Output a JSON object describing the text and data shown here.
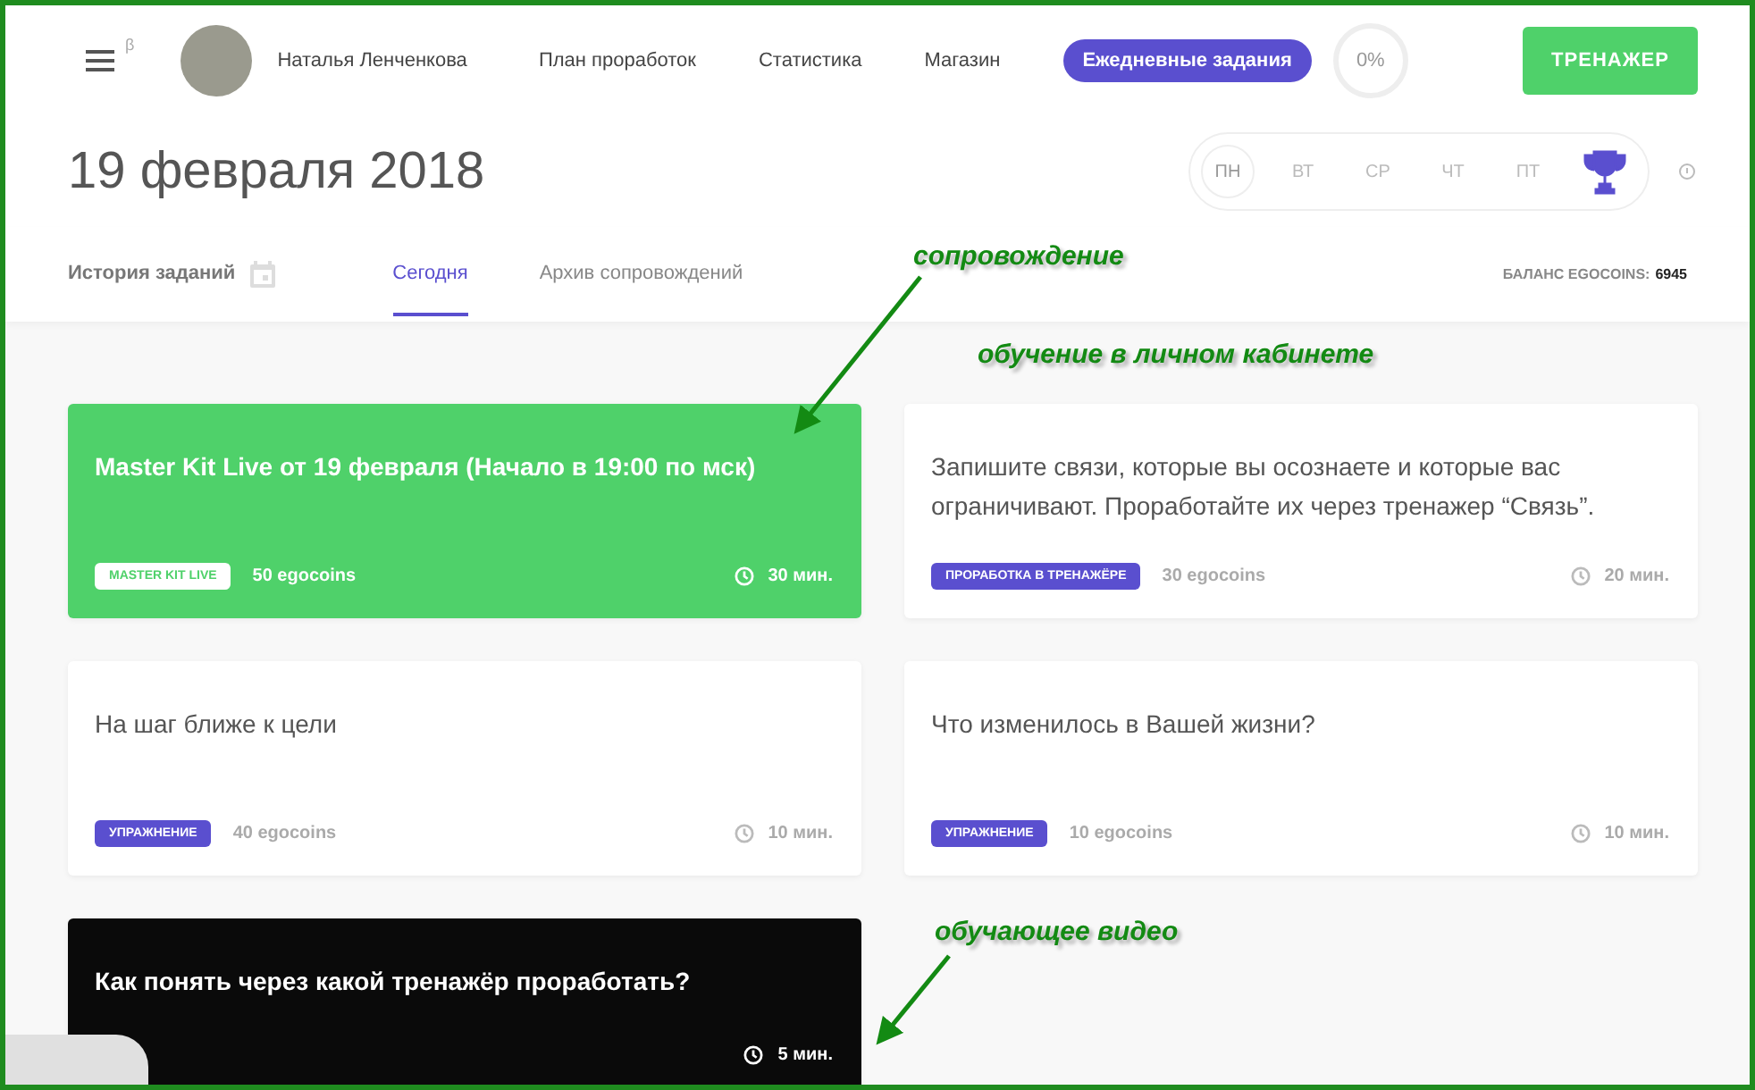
{
  "header": {
    "beta_mark": "β",
    "user_name": "Наталья Ленченкова",
    "nav": [
      {
        "label": "План проработок",
        "selected": false
      },
      {
        "label": "Статистика",
        "selected": false
      },
      {
        "label": "Магазин",
        "selected": false
      },
      {
        "label": "Ежедневные задания",
        "selected": true
      }
    ],
    "progress": "0%",
    "trainer_button": "ТРЕНАЖЕР"
  },
  "date_title": "19 февраля 2018",
  "week_days": [
    {
      "label": "ПН",
      "selected": true
    },
    {
      "label": "ВТ",
      "selected": false
    },
    {
      "label": "СР",
      "selected": false
    },
    {
      "label": "ЧТ",
      "selected": false
    },
    {
      "label": "ПТ",
      "selected": false
    }
  ],
  "tabs": [
    {
      "label": "История заданий",
      "kind": "history",
      "selected": false
    },
    {
      "label": "Сегодня",
      "kind": "tab",
      "selected": true
    },
    {
      "label": "Архив сопровождений",
      "kind": "tab",
      "selected": false
    }
  ],
  "balance": {
    "label": "БАЛАНС EGOCOINS:",
    "value": "6945"
  },
  "cards": [
    {
      "kind": "highlight",
      "title": "Master Kit Live от 19 февраля (Начало в 19:00 по мск)",
      "tag": "MASTER KIT LIVE",
      "coins": "50 egocoins",
      "time": "30 мин."
    },
    {
      "kind": "plain",
      "title": "Запишите связи, которые вы осознаете и которые вас ограничивают. Проработайте их через тренажер “Связь”.",
      "tag": "ПРОРАБОТКА В ТРЕНАЖЁРЕ",
      "coins": "30 egocoins",
      "time": "20 мин."
    },
    {
      "kind": "plain",
      "title": "На шаг ближе к цели",
      "tag": "УПРАЖНЕНИЕ",
      "coins": "40 egocoins",
      "time": "10 мин."
    },
    {
      "kind": "plain",
      "title": "Что изменилось в Вашей жизни?",
      "tag": "УПРАЖНЕНИЕ",
      "coins": "10 egocoins",
      "time": "10 мин."
    },
    {
      "kind": "video",
      "title": "Как понять через какой тренажёр проработать?",
      "time": "5 мин."
    }
  ],
  "annotations": [
    {
      "text": "сопровождение"
    },
    {
      "text": "обучение в личном кабинете"
    },
    {
      "text": "обучающее видео"
    }
  ]
}
